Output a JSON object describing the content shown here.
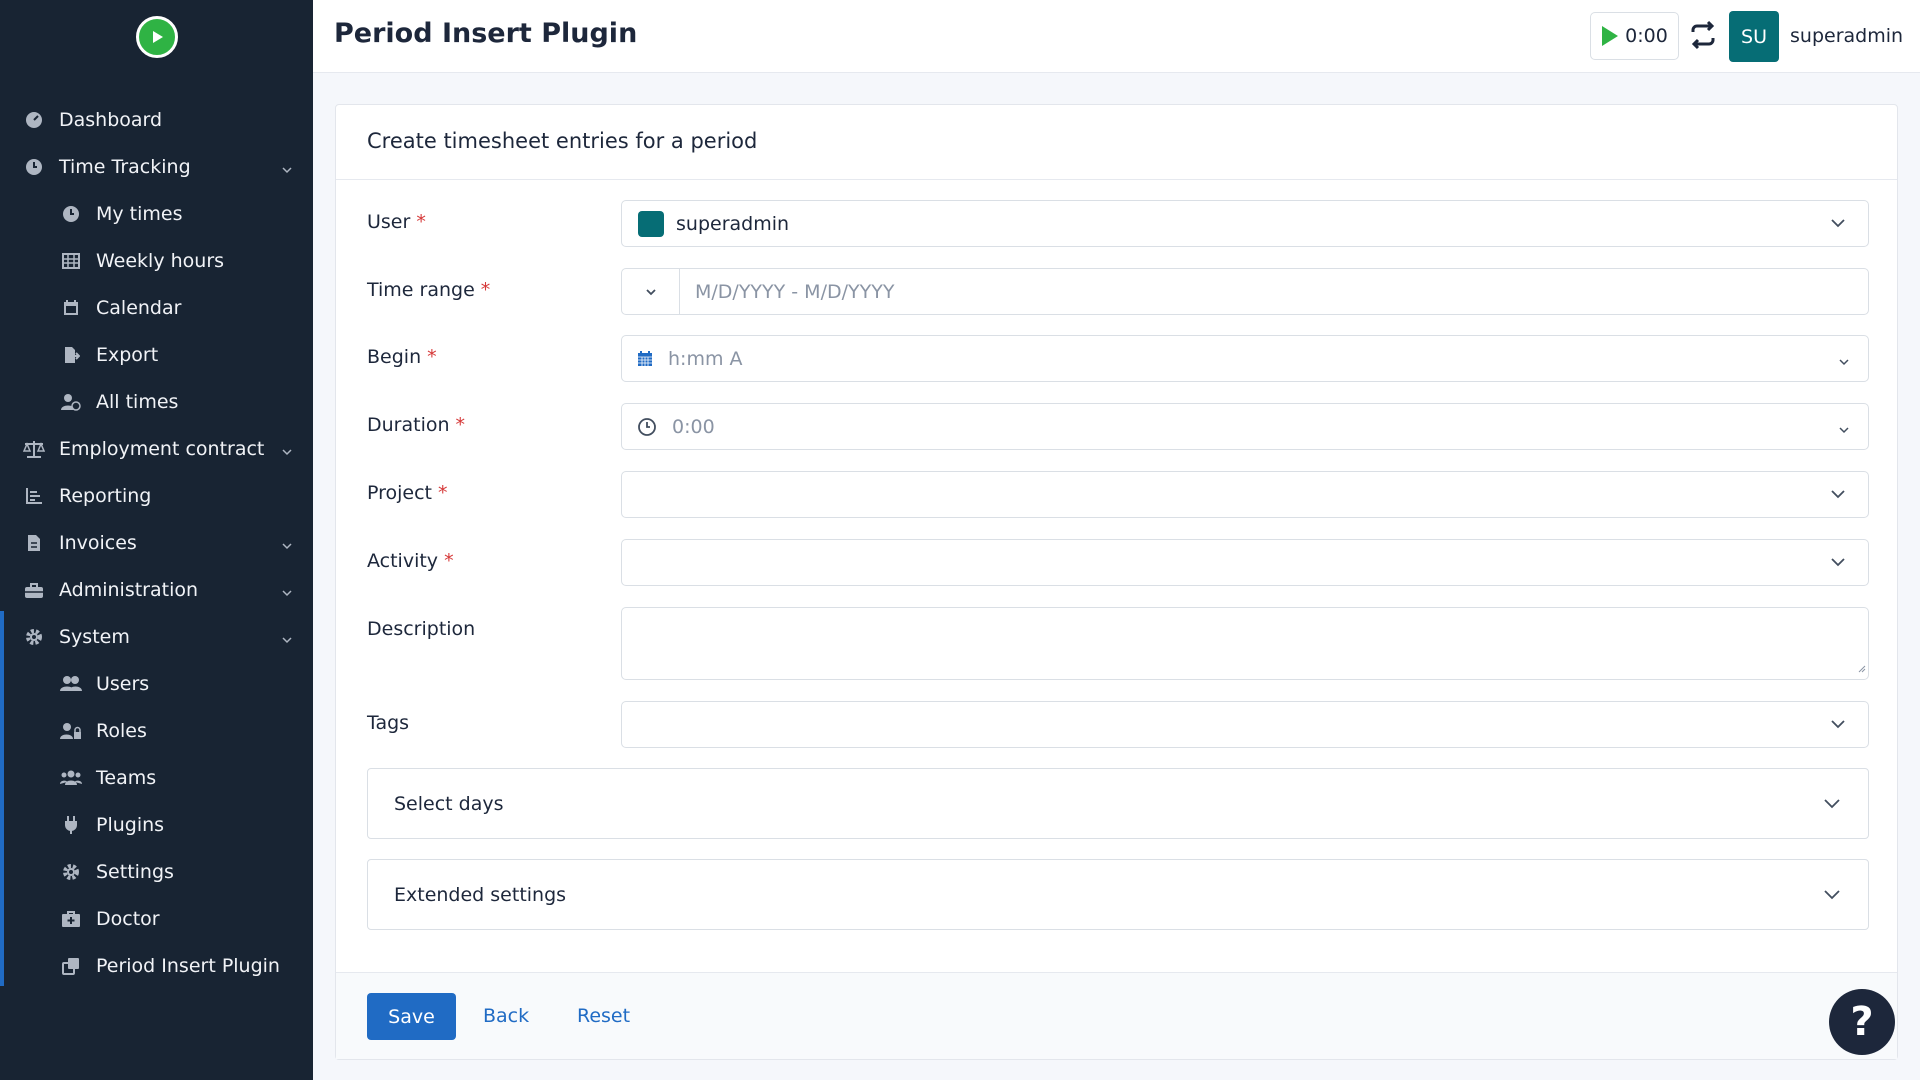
{
  "sidebar": {
    "items": [
      {
        "label": "Dashboard",
        "icon": "dashboard-icon"
      },
      {
        "label": "Time Tracking",
        "icon": "clock-icon",
        "expandable": true
      },
      {
        "label": "My times",
        "icon": "clock-icon",
        "sub": true
      },
      {
        "label": "Weekly hours",
        "icon": "table-icon",
        "sub": true
      },
      {
        "label": "Calendar",
        "icon": "calendar-icon",
        "sub": true
      },
      {
        "label": "Export",
        "icon": "export-icon",
        "sub": true
      },
      {
        "label": "All times",
        "icon": "user-clock-icon",
        "sub": true
      },
      {
        "label": "Employment contract",
        "icon": "scale-icon",
        "expandable": true
      },
      {
        "label": "Reporting",
        "icon": "chart-icon"
      },
      {
        "label": "Invoices",
        "icon": "invoice-icon",
        "expandable": true
      },
      {
        "label": "Administration",
        "icon": "toolbox-icon",
        "expandable": true
      },
      {
        "label": "System",
        "icon": "gear-icon",
        "expandable": true
      },
      {
        "label": "Users",
        "icon": "users-icon",
        "sub": true
      },
      {
        "label": "Roles",
        "icon": "user-lock-icon",
        "sub": true
      },
      {
        "label": "Teams",
        "icon": "team-icon",
        "sub": true
      },
      {
        "label": "Plugins",
        "icon": "plug-icon",
        "sub": true
      },
      {
        "label": "Settings",
        "icon": "gear-icon",
        "sub": true
      },
      {
        "label": "Doctor",
        "icon": "medkit-icon",
        "sub": true
      },
      {
        "label": "Period Insert Plugin",
        "icon": "clone-icon",
        "sub": true
      }
    ]
  },
  "header": {
    "title": "Period Insert Plugin",
    "timer": "0:00",
    "avatar_initials": "SU",
    "username": "superadmin"
  },
  "form": {
    "card_title": "Create timesheet entries for a period",
    "user_label": "User",
    "user_value": "superadmin",
    "time_range_label": "Time range",
    "time_range_placeholder": "M/D/YYYY - M/D/YYYY",
    "begin_label": "Begin",
    "begin_placeholder": "h:mm A",
    "duration_label": "Duration",
    "duration_placeholder": "0:00",
    "project_label": "Project",
    "activity_label": "Activity",
    "description_label": "Description",
    "tags_label": "Tags",
    "select_days": "Select days",
    "extended_settings": "Extended settings",
    "required_mark": "*"
  },
  "footer": {
    "save": "Save",
    "back": "Back",
    "reset": "Reset"
  },
  "help": "?",
  "colors": {
    "sidebar_bg": "#182433",
    "accent": "#206bc4",
    "avatar_bg": "#066d75",
    "timer_green": "#2fb344",
    "required": "#d63939"
  }
}
